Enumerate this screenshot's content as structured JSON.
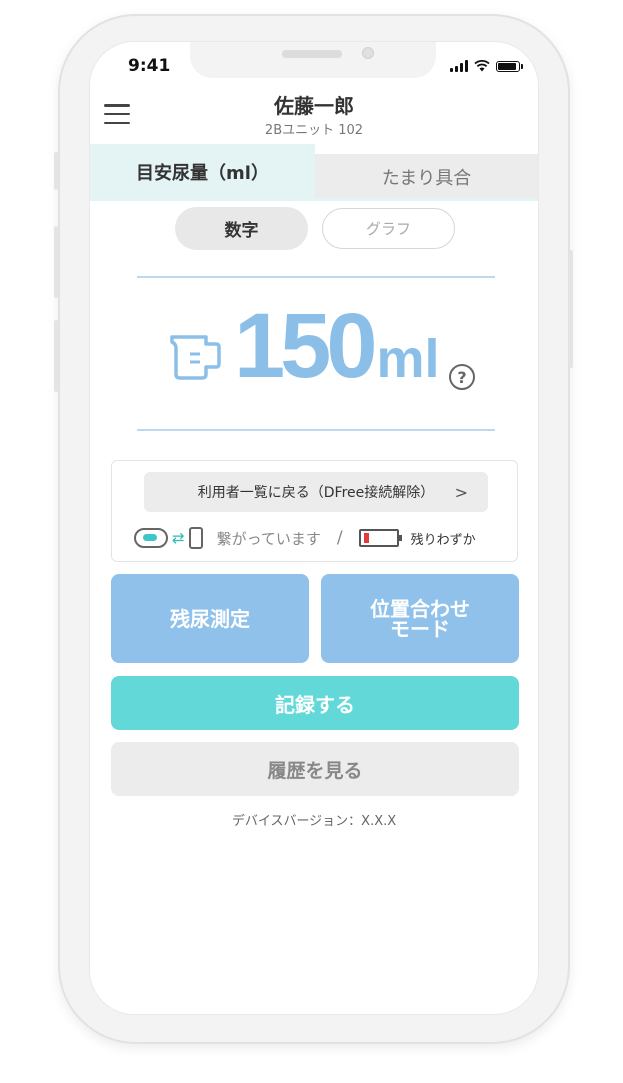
{
  "status_bar": {
    "time": "9:41"
  },
  "header": {
    "user_name": "佐藤一郎",
    "unit": "2Bユニット 102"
  },
  "tabs": [
    {
      "label": "目安尿量（ml）",
      "active": true
    },
    {
      "label": "たまり具合",
      "active": false
    }
  ],
  "view_toggle": {
    "numeric_label": "数字",
    "graph_label": "グラフ",
    "selected": "数字"
  },
  "measurement": {
    "value": "150",
    "unit": "ml",
    "help_symbol": "?"
  },
  "device": {
    "back_label": "利用者一覧に戻る（DFree接続解除）",
    "back_chevron": ">",
    "connection_status": "繋がっています",
    "separator": "/",
    "battery_status": "残りわずか",
    "battery_color": "#e23b3b"
  },
  "actions": {
    "residual_label": "残尿測定",
    "position_label": "位置合わせ\nモード",
    "record_label": "記録する",
    "history_label": "履歴を見る"
  },
  "footer": {
    "version": "デバイスバージョン：X.X.X"
  },
  "colors": {
    "accent_blue": "#8fc1ea",
    "accent_teal": "#62d8d8",
    "amount_blue": "#8bbfe8"
  }
}
